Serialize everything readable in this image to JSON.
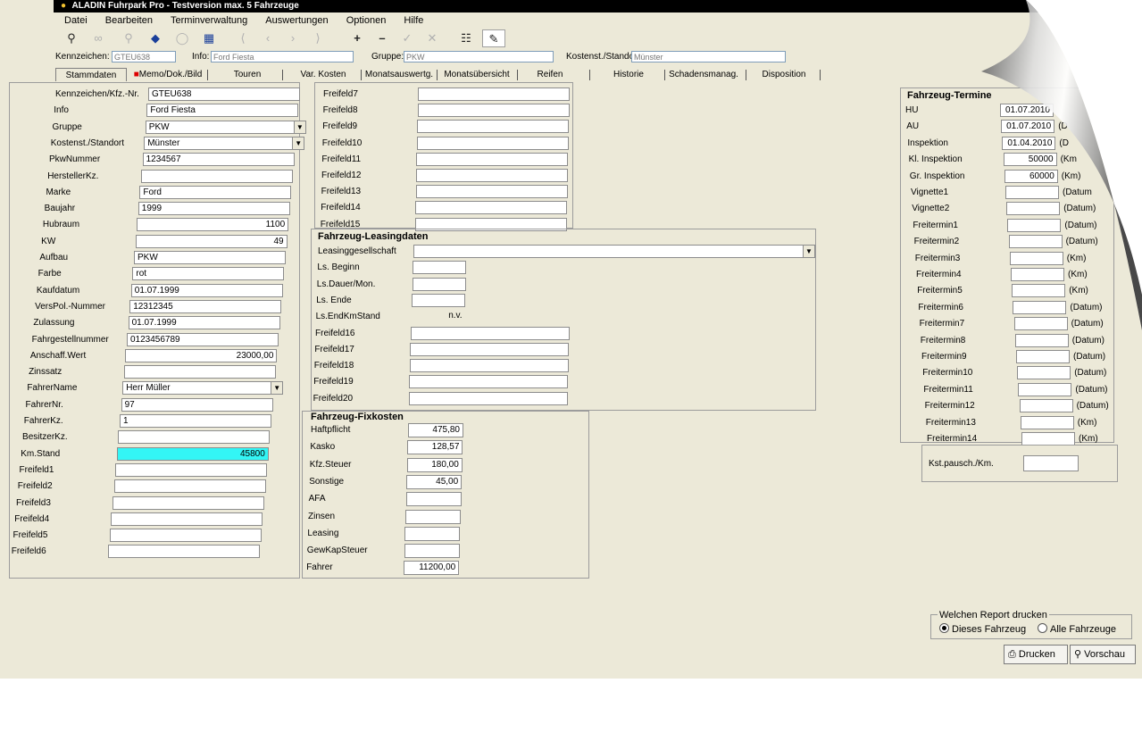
{
  "window": {
    "title": "ALADIN Fuhrpark Pro - Testversion  max. 5 Fahrzeuge"
  },
  "menu": [
    "Datei",
    "Bearbeiten",
    "Terminverwaltung",
    "Auswertungen",
    "Optionen",
    "Hilfe"
  ],
  "toolbar_icons": [
    "search-icon",
    "binoculars-icon",
    "zoom-icon",
    "tag-icon",
    "eraser-icon",
    "calendar-icon",
    "first-icon",
    "prev-icon",
    "next-icon",
    "last-icon",
    "plus-icon",
    "minus-icon",
    "check-icon",
    "cross-icon",
    "grid-icon",
    "edit-icon"
  ],
  "info": {
    "kennzeichen_label": "Kennzeichen:",
    "kennzeichen": "GTEU638",
    "info_label": "Info:",
    "info": "Ford Fiesta",
    "gruppe_label": "Gruppe:",
    "gruppe": "PKW",
    "kostenst_label": "Kostenst./Stando",
    "kostenst": "Münster"
  },
  "tabs": [
    "Stammdaten",
    "Memo/Dok./Bild",
    "Touren",
    "Var. Kosten",
    "Monatsauswertg.",
    "Monatsübersicht",
    "Reifen",
    "Historie",
    "Schadensmanag.",
    "Disposition"
  ],
  "stamm": [
    {
      "label": "Kennzeichen/Kfz.-Nr.",
      "value": ""
    },
    {
      "label": "Info",
      "value": "Ford Fiesta"
    },
    {
      "label": "Gruppe",
      "value": "PKW"
    },
    {
      "label": "Kostenst./Standort",
      "value": "Münster"
    },
    {
      "label": "PkwNummer",
      "value": "1234567"
    },
    {
      "label": "HerstellerKz.",
      "value": ""
    },
    {
      "label": "Marke",
      "value": "Ford"
    },
    {
      "label": "Baujahr",
      "value": "1999"
    },
    {
      "label": "Hubraum",
      "value": "1100"
    },
    {
      "label": "KW",
      "value": "49"
    },
    {
      "label": "Aufbau",
      "value": "PKW"
    },
    {
      "label": "Farbe",
      "value": "rot"
    },
    {
      "label": "Kaufdatum",
      "value": "01.07.1999"
    },
    {
      "label": "VersPol.-Nummer",
      "value": "12312345"
    },
    {
      "label": "Zulassung",
      "value": "01.07.1999"
    },
    {
      "label": "Fahrgestellnummer",
      "value": "0123456789"
    },
    {
      "label": "Anschaff.Wert",
      "value": "23000,00"
    },
    {
      "label": "Zinssatz",
      "value": ""
    },
    {
      "label": "FahrerName",
      "value": "Herr Müller"
    },
    {
      "label": "FahrerNr.",
      "value": "97"
    },
    {
      "label": "FahrerKz.",
      "value": "1"
    },
    {
      "label": "BesitzerKz.",
      "value": ""
    },
    {
      "label": "Km.Stand",
      "value": "45800"
    },
    {
      "label": "Freifeld1",
      "value": ""
    },
    {
      "label": "Freifeld2",
      "value": ""
    },
    {
      "label": "Freifeld3",
      "value": ""
    },
    {
      "label": "Freifeld4",
      "value": ""
    },
    {
      "label": "Freifeld5",
      "value": ""
    },
    {
      "label": "Freifeld6",
      "value": ""
    }
  ],
  "kennzeichen_value": "GTEU638",
  "freifelder_mid": [
    {
      "label": "Freifeld7",
      "value": ""
    },
    {
      "label": "Freifeld8",
      "value": ""
    },
    {
      "label": "Freifeld9",
      "value": ""
    },
    {
      "label": "Freifeld10",
      "value": ""
    },
    {
      "label": "Freifeld11",
      "value": ""
    },
    {
      "label": "Freifeld12",
      "value": ""
    },
    {
      "label": "Freifeld13",
      "value": ""
    },
    {
      "label": "Freifeld14",
      "value": ""
    },
    {
      "label": "Freifeld15",
      "value": ""
    }
  ],
  "leasing": {
    "title": "Fahrzeug-Leasingdaten",
    "rows": [
      {
        "label": "Leasinggesellschaft",
        "value": ""
      },
      {
        "label": "Ls. Beginn",
        "value": ""
      },
      {
        "label": "Ls.Dauer/Mon.",
        "value": ""
      },
      {
        "label": "Ls. Ende",
        "value": ""
      },
      {
        "label": "Ls.EndKmStand",
        "value": "n.v."
      },
      {
        "label": "Freifeld16",
        "value": ""
      },
      {
        "label": "Freifeld17",
        "value": ""
      },
      {
        "label": "Freifeld18",
        "value": ""
      },
      {
        "label": "Freifeld19",
        "value": ""
      },
      {
        "label": "Freifeld20",
        "value": ""
      }
    ]
  },
  "fixkosten": {
    "title": "Fahrzeug-Fixkosten",
    "rows": [
      {
        "label": "Haftpflicht",
        "value": "475,80"
      },
      {
        "label": "Kasko",
        "value": "128,57"
      },
      {
        "label": "Kfz.Steuer",
        "value": "180,00"
      },
      {
        "label": "Sonstige",
        "value": "45,00"
      },
      {
        "label": "AFA",
        "value": ""
      },
      {
        "label": "Zinsen",
        "value": ""
      },
      {
        "label": "Leasing",
        "value": ""
      },
      {
        "label": "GewKapSteuer",
        "value": ""
      },
      {
        "label": "Fahrer",
        "value": "11200,00"
      }
    ]
  },
  "termine": {
    "title": "Fahrzeug-Termine",
    "rows": [
      {
        "label": "HU",
        "value": "01.07.2010",
        "unit": ""
      },
      {
        "label": "AU",
        "value": "01.07.2010",
        "unit": "(D"
      },
      {
        "label": "Inspektion",
        "value": "01.04.2010",
        "unit": "(D"
      },
      {
        "label": "Kl. Inspektion",
        "value": "50000",
        "unit": "(Km"
      },
      {
        "label": "Gr. Inspektion",
        "value": "60000",
        "unit": "(Km)"
      },
      {
        "label": "Vignette1",
        "value": "",
        "unit": "(Datum"
      },
      {
        "label": "Vignette2",
        "value": "",
        "unit": "(Datum)"
      },
      {
        "label": "Freitermin1",
        "value": "",
        "unit": "(Datum)"
      },
      {
        "label": "Freitermin2",
        "value": "",
        "unit": "(Datum)"
      },
      {
        "label": "Freitermin3",
        "value": "",
        "unit": "(Km)"
      },
      {
        "label": "Freitermin4",
        "value": "",
        "unit": "(Km)"
      },
      {
        "label": "Freitermin5",
        "value": "",
        "unit": "(Km)"
      },
      {
        "label": "Freitermin6",
        "value": "",
        "unit": "(Datum)"
      },
      {
        "label": "Freitermin7",
        "value": "",
        "unit": "(Datum)"
      },
      {
        "label": "Freitermin8",
        "value": "",
        "unit": "(Datum)"
      },
      {
        "label": "Freitermin9",
        "value": "",
        "unit": "(Datum)"
      },
      {
        "label": "Freitermin10",
        "value": "",
        "unit": "(Datum)"
      },
      {
        "label": "Freitermin11",
        "value": "",
        "unit": "(Datum)"
      },
      {
        "label": "Freitermin12",
        "value": "",
        "unit": "(Datum)"
      },
      {
        "label": "Freitermin13",
        "value": "",
        "unit": "(Km)"
      },
      {
        "label": "Freitermin14",
        "value": "",
        "unit": "(Km)"
      }
    ],
    "pausch_label": "Kst.pausch./Km.",
    "pausch_value": ""
  },
  "report": {
    "title": "Welchen Report drucken",
    "option1": "Dieses Fahrzeug",
    "option2": "Alle Fahrzeuge",
    "print": "Drucken",
    "preview": "Vorschau"
  }
}
